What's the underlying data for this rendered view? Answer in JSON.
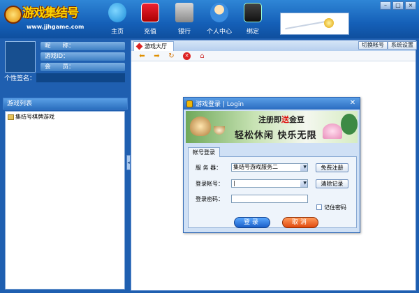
{
  "app": {
    "logo_text": "游戏集结号",
    "logo_url": "www.jjhgame.com"
  },
  "nav": [
    {
      "label": "主页",
      "icon": "home-icon"
    },
    {
      "label": "充值",
      "icon": "card-icon"
    },
    {
      "label": "银行",
      "icon": "bank-icon"
    },
    {
      "label": "个人中心",
      "icon": "user-icon"
    },
    {
      "label": "绑定",
      "icon": "phone-icon"
    }
  ],
  "window_controls": {
    "minimize": "–",
    "maximize": "□",
    "close": "×"
  },
  "profile": {
    "nickname_label": "昵　　称：",
    "game_id_label": "游戏ID：",
    "member_label": "会　　员：",
    "signature_label": "个性签名："
  },
  "game_list": {
    "title": "游戏列表",
    "items": [
      {
        "label": "集结号棋牌游戏"
      }
    ]
  },
  "tabs": [
    {
      "label": "游戏大厅"
    }
  ],
  "top_buttons": {
    "switch_account": "切换帐号",
    "settings": "系统设置"
  },
  "login_dialog": {
    "title": "游戏登录 | Login",
    "close": "✕",
    "banner": {
      "line1_a": "注册即",
      "line1_b": "送",
      "line1_c": "金豆",
      "line2": "轻松休闲 快乐无限"
    },
    "form_tab": "帐号登录",
    "server_label": "服 务 器：",
    "server_value": "集结号游戏服务二",
    "free_register": "免费注册",
    "account_label": "登录帐号：",
    "account_value": "|",
    "clear_records": "清除记录",
    "password_label": "登录密码：",
    "password_value": "",
    "remember_password": "记住密码",
    "login_button": "登录",
    "cancel_button": "取消"
  }
}
